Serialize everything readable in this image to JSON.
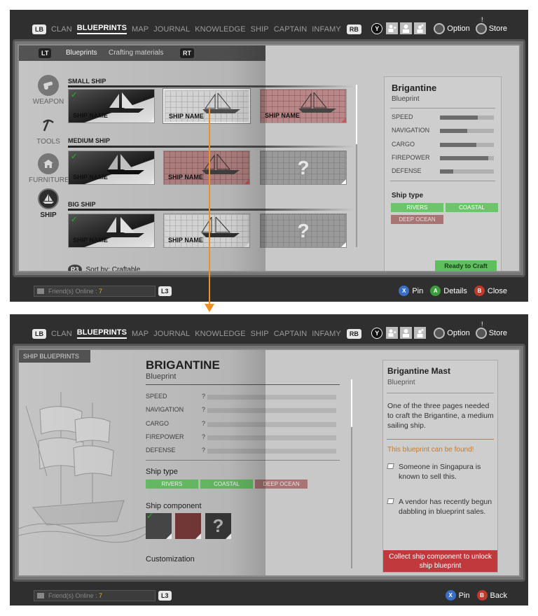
{
  "colors": {
    "accent_orange": "#f0901e",
    "green": "#6cc56a",
    "red": "#c0393c",
    "friends_count": "#e0a82e"
  },
  "screen1": {
    "nav": {
      "lb": "LB",
      "rb": "RB",
      "items": [
        "CLAN",
        "BLUEPRINTS",
        "MAP",
        "JOURNAL",
        "KNOWLEDGE",
        "SHIP",
        "CAPTAIN",
        "INFAMY"
      ],
      "active": "BLUEPRINTS"
    },
    "topright": {
      "y": "Y",
      "option": "Option",
      "store": "Store",
      "store_badge": "!"
    },
    "tabs": {
      "lt": "LT",
      "rt": "RT",
      "blueprints": "Blueprints",
      "crafting": "Crafting materials"
    },
    "categories": [
      {
        "label": "WEAPON",
        "icon": "cannon-icon"
      },
      {
        "label": "TOOLS",
        "icon": "pickaxe-icon"
      },
      {
        "label": "FURNITURE",
        "icon": "house-icon"
      },
      {
        "label": "SHIP",
        "icon": "ship-icon"
      }
    ],
    "sections": {
      "small": "SMALL SHIP",
      "medium": "MEDIUM SHIP",
      "big": "BIG SHIP"
    },
    "card_name": "SHIP NAME",
    "unknown": "?",
    "sort": {
      "btn": "R3",
      "label": "Sort by: Craftable"
    },
    "detail": {
      "title": "Brigantine",
      "subtitle": "Blueprint",
      "stats": [
        {
          "label": "SPEED",
          "value": 0.7
        },
        {
          "label": "NAVIGATION",
          "value": 0.5
        },
        {
          "label": "CARGO",
          "value": 0.68
        },
        {
          "label": "FIREPOWER",
          "value": 0.9
        },
        {
          "label": "DEFENSE",
          "value": 0.25
        }
      ],
      "ship_type_label": "Ship type",
      "types": {
        "rivers": "RIVERS",
        "coastal": "COASTAL",
        "deep": "DEEP OCEAN"
      },
      "craft": "Ready to Craft"
    },
    "bottom": {
      "friends_label": "Friend(s) Online : ",
      "friends_count": "7",
      "l3": "L3",
      "x": "X",
      "pin": "Pin",
      "a": "A",
      "details": "Details",
      "b": "B",
      "close": "Close"
    }
  },
  "screen2": {
    "nav": {
      "lb": "LB",
      "rb": "RB",
      "items": [
        "CLAN",
        "BLUEPRINTS",
        "MAP",
        "JOURNAL",
        "KNOWLEDGE",
        "SHIP",
        "CAPTAIN",
        "INFAMY"
      ],
      "active": "BLUEPRINTS"
    },
    "topright": {
      "y": "Y",
      "option": "Option",
      "store": "Store",
      "store_badge": "!"
    },
    "tab": "SHIP BLUEPRINTS",
    "title": "BRIGANTINE",
    "subtitle": "Blueprint",
    "stats": [
      {
        "label": "SPEED",
        "value": "?"
      },
      {
        "label": "NAVIGATION",
        "value": "?"
      },
      {
        "label": "CARGO",
        "value": "?"
      },
      {
        "label": "FIREPOWER",
        "value": "?"
      },
      {
        "label": "DEFENSE",
        "value": "?"
      }
    ],
    "ship_type_label": "Ship type",
    "types": {
      "rivers": "RIVERS",
      "coastal": "COASTAL",
      "deep": "DEEP OCEAN"
    },
    "component_label": "Ship component",
    "component_unknown": "?",
    "customization": "Customization",
    "detail": {
      "title": "Brigantine Mast",
      "subtitle": "Blueprint",
      "desc": "One of the three pages needed to craft the Brigantine, a medium sailing ship.",
      "found": "This blueprint can be found!",
      "hint1": "Someone in Singapura is known to sell this.",
      "hint2": "A vendor has recently begun dabbling in blueprint sales.",
      "collect": "Collect ship component to unlock ship blueprint"
    },
    "bottom": {
      "friends_label": "Friend(s) Online : ",
      "friends_count": "7",
      "l3": "L3",
      "x": "X",
      "pin": "Pin",
      "b": "B",
      "back": "Back"
    }
  }
}
